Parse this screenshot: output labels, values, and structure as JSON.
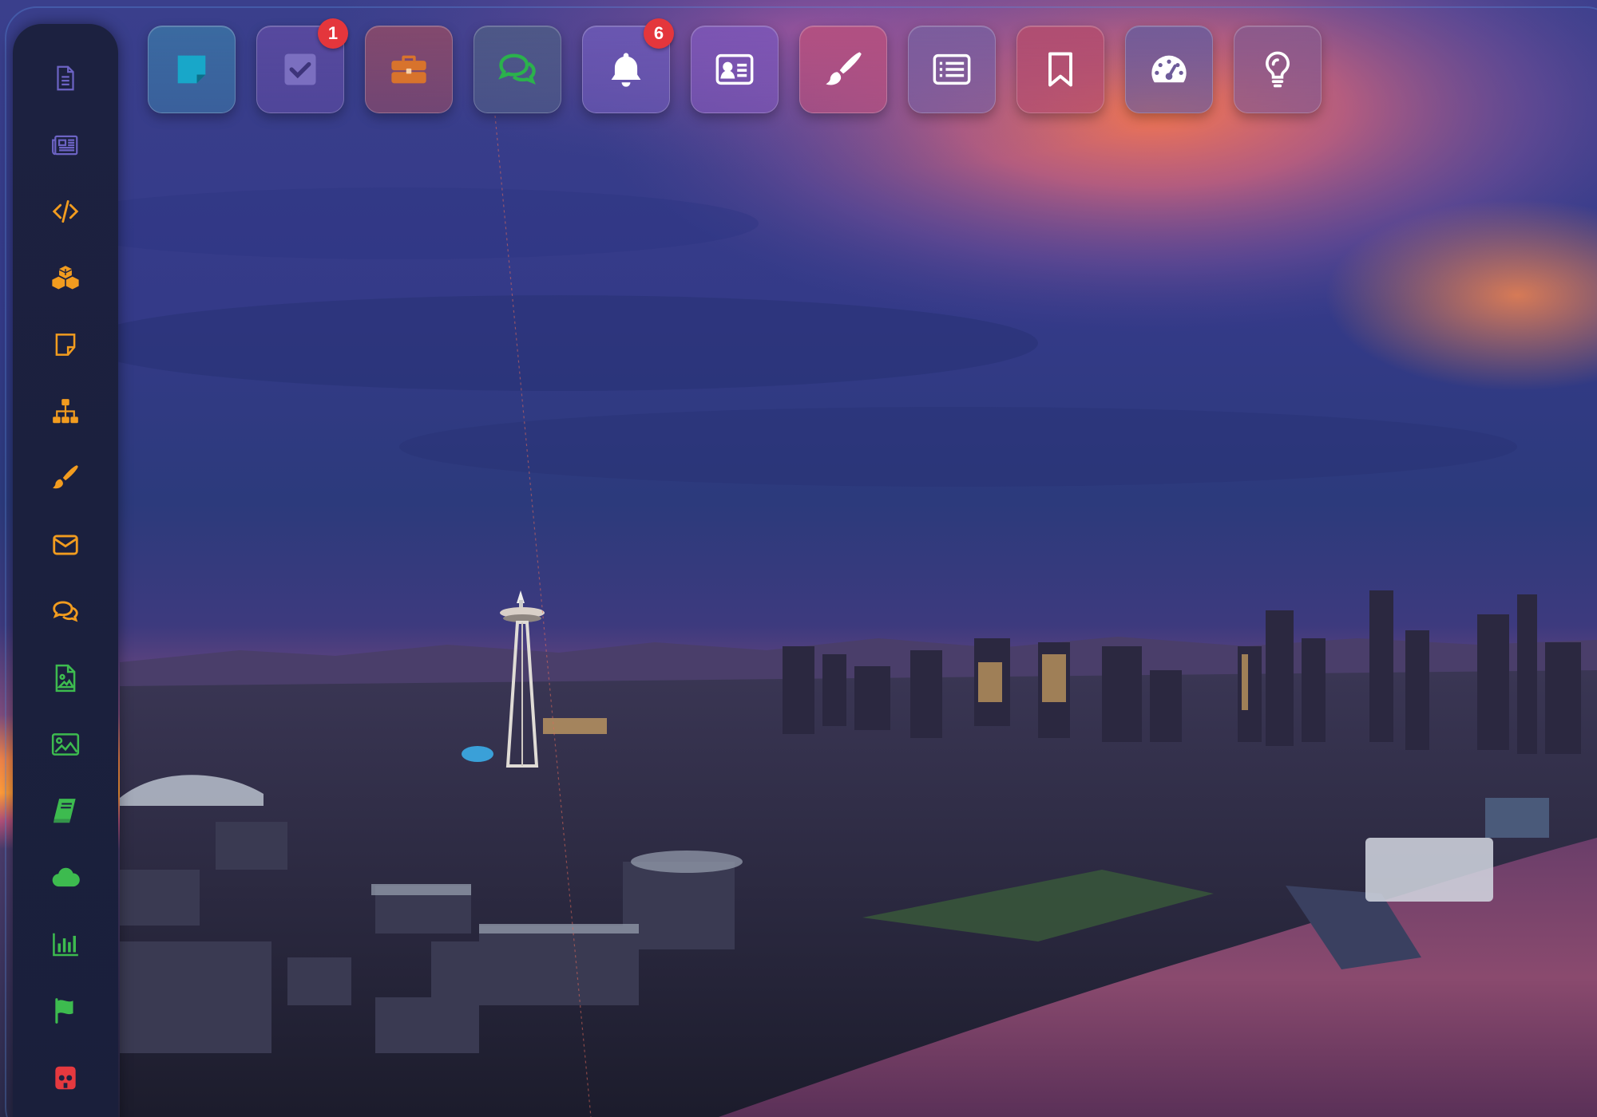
{
  "dock": {
    "items": [
      {
        "name": "sticky-note-icon",
        "color": "#3b6fa3",
        "icon_color": "#18a7c9"
      },
      {
        "name": "checkbox-icon",
        "color": "#5a4aa0",
        "icon_color": "#7b6fc0",
        "badge": "1"
      },
      {
        "name": "briefcase-icon",
        "color": "#8a4a6a",
        "icon_color": "#d8732c"
      },
      {
        "name": "chat-bubbles-icon",
        "color": "#4e5a86",
        "icon_color": "#2bb24c"
      },
      {
        "name": "bell-icon",
        "color": "#6b58b4",
        "icon_color": "#ffffff",
        "badge": "6"
      },
      {
        "name": "id-card-icon",
        "color": "#7c56b6",
        "icon_color": "#ffffff"
      },
      {
        "name": "paintbrush-icon",
        "color": "#b5507f",
        "icon_color": "#ffffff"
      },
      {
        "name": "list-icon",
        "color": "#7a5e9e",
        "icon_color": "#ffffff"
      },
      {
        "name": "bookmark-icon",
        "color": "#b24d6f",
        "icon_color": "#ffffff"
      },
      {
        "name": "dashboard-gauge-icon",
        "color": "#6e5c9a",
        "icon_color": "#ffffff"
      },
      {
        "name": "lightbulb-icon",
        "color": "#8a5a8c",
        "icon_color": "#ffffff"
      }
    ]
  },
  "sidebar": {
    "items": [
      {
        "name": "document-icon",
        "color": "#6c63c4"
      },
      {
        "name": "newspaper-icon",
        "color": "#6c63c4"
      },
      {
        "name": "code-icon",
        "color": "#f29c1f"
      },
      {
        "name": "cubes-icon",
        "color": "#f29c1f"
      },
      {
        "name": "sticky-note-icon",
        "color": "#f29c1f"
      },
      {
        "name": "sitemap-icon",
        "color": "#f29c1f"
      },
      {
        "name": "paintbrush-icon",
        "color": "#f29c1f"
      },
      {
        "name": "envelope-icon",
        "color": "#f29c1f"
      },
      {
        "name": "chat-bubbles-icon",
        "color": "#f29c1f"
      },
      {
        "name": "image-file-icon",
        "color": "#3dbb4f"
      },
      {
        "name": "image-icon",
        "color": "#3dbb4f"
      },
      {
        "name": "book-icon",
        "color": "#3dbb4f"
      },
      {
        "name": "cloud-icon",
        "color": "#3dbb4f"
      },
      {
        "name": "bar-chart-icon",
        "color": "#3dbb4f"
      },
      {
        "name": "flag-icon",
        "color": "#3dbb4f"
      },
      {
        "name": "bug-icon",
        "color": "#e5393f"
      }
    ]
  }
}
